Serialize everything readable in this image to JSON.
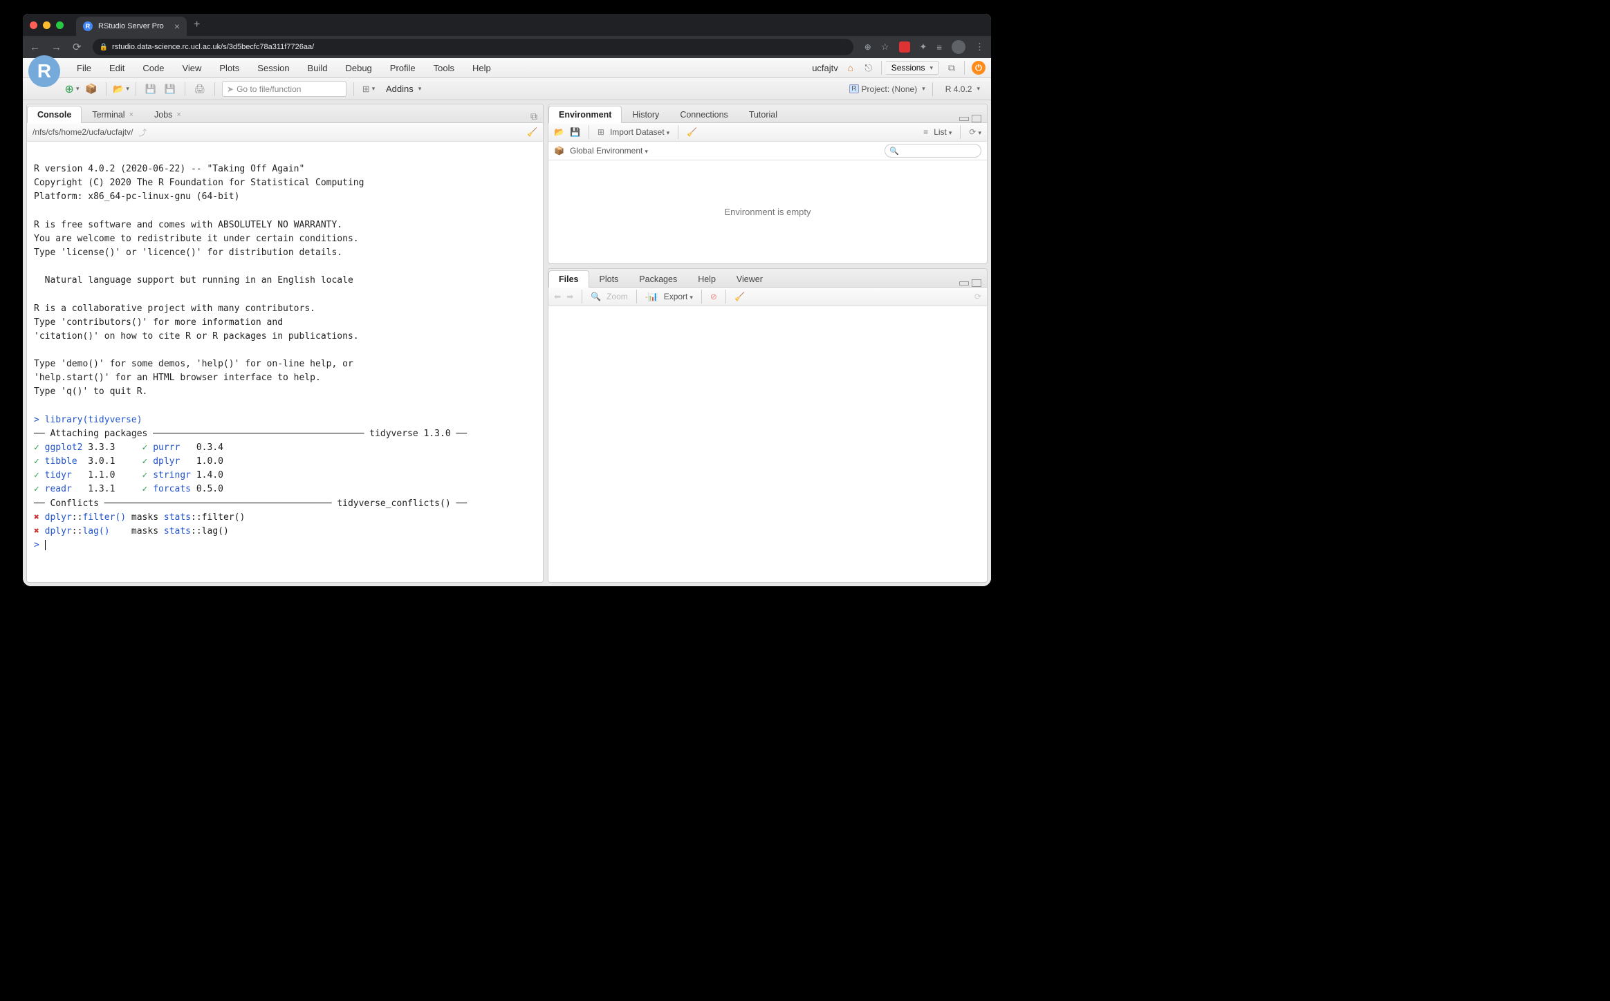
{
  "browser": {
    "tab_title": "RStudio Server Pro",
    "url": "rstudio.data-science.rc.ucl.ac.uk/s/3d5becfc78a311f7726aa/"
  },
  "menubar": {
    "items": [
      "File",
      "Edit",
      "Code",
      "View",
      "Plots",
      "Session",
      "Build",
      "Debug",
      "Profile",
      "Tools",
      "Help"
    ],
    "username": "ucfajtv",
    "sessions": "Sessions"
  },
  "toolbar": {
    "goto_placeholder": "Go to file/function",
    "addins": "Addins",
    "project": "Project: (None)",
    "r_version": "R 4.0.2"
  },
  "console": {
    "tabs": [
      "Console",
      "Terminal",
      "Jobs"
    ],
    "path": "/nfs/cfs/home2/ucfa/ucfajtv/",
    "banner": "\nR version 4.0.2 (2020-06-22) -- \"Taking Off Again\"\nCopyright (C) 2020 The R Foundation for Statistical Computing\nPlatform: x86_64-pc-linux-gnu (64-bit)\n\nR is free software and comes with ABSOLUTELY NO WARRANTY.\nYou are welcome to redistribute it under certain conditions.\nType 'license()' or 'licence()' for distribution details.\n\n  Natural language support but running in an English locale\n\nR is a collaborative project with many contributors.\nType 'contributors()' for more information and\n'citation()' on how to cite R or R packages in publications.\n\nType 'demo()' for some demos, 'help()' for on-line help, or\n'help.start()' for an HTML browser interface to help.\nType 'q()' to quit R.\n",
    "command": "library(tidyverse)",
    "attaching_header": "── Attaching packages ─────────────────────────────────────── tidyverse 1.3.0 ──",
    "packages_left": [
      {
        "name": "ggplot2",
        "ver": "3.3.3"
      },
      {
        "name": "tibble",
        "ver": "3.0.1"
      },
      {
        "name": "tidyr",
        "ver": "1.1.0"
      },
      {
        "name": "readr",
        "ver": "1.3.1"
      }
    ],
    "packages_right": [
      {
        "name": "purrr",
        "ver": "0.3.4"
      },
      {
        "name": "dplyr",
        "ver": "1.0.0"
      },
      {
        "name": "stringr",
        "ver": "1.4.0"
      },
      {
        "name": "forcats",
        "ver": "0.5.0"
      }
    ],
    "conflicts_header": "── Conflicts ────────────────────────────────────────── tidyverse_conflicts() ──",
    "conflicts": [
      {
        "ns1": "dplyr",
        "fn1": "filter()",
        "masks": " masks ",
        "ns2": "stats",
        "fn2": "filter()"
      },
      {
        "ns1": "dplyr",
        "fn1": "lag()",
        "pad": "   ",
        "masks": " masks ",
        "ns2": "stats",
        "fn2": "lag()"
      }
    ]
  },
  "environment": {
    "tabs": [
      "Environment",
      "History",
      "Connections",
      "Tutorial"
    ],
    "import": "Import Dataset",
    "list": "List",
    "scope": "Global Environment",
    "empty": "Environment is empty"
  },
  "files_pane": {
    "tabs": [
      "Files",
      "Plots",
      "Packages",
      "Help",
      "Viewer"
    ],
    "zoom": "Zoom",
    "export": "Export"
  }
}
